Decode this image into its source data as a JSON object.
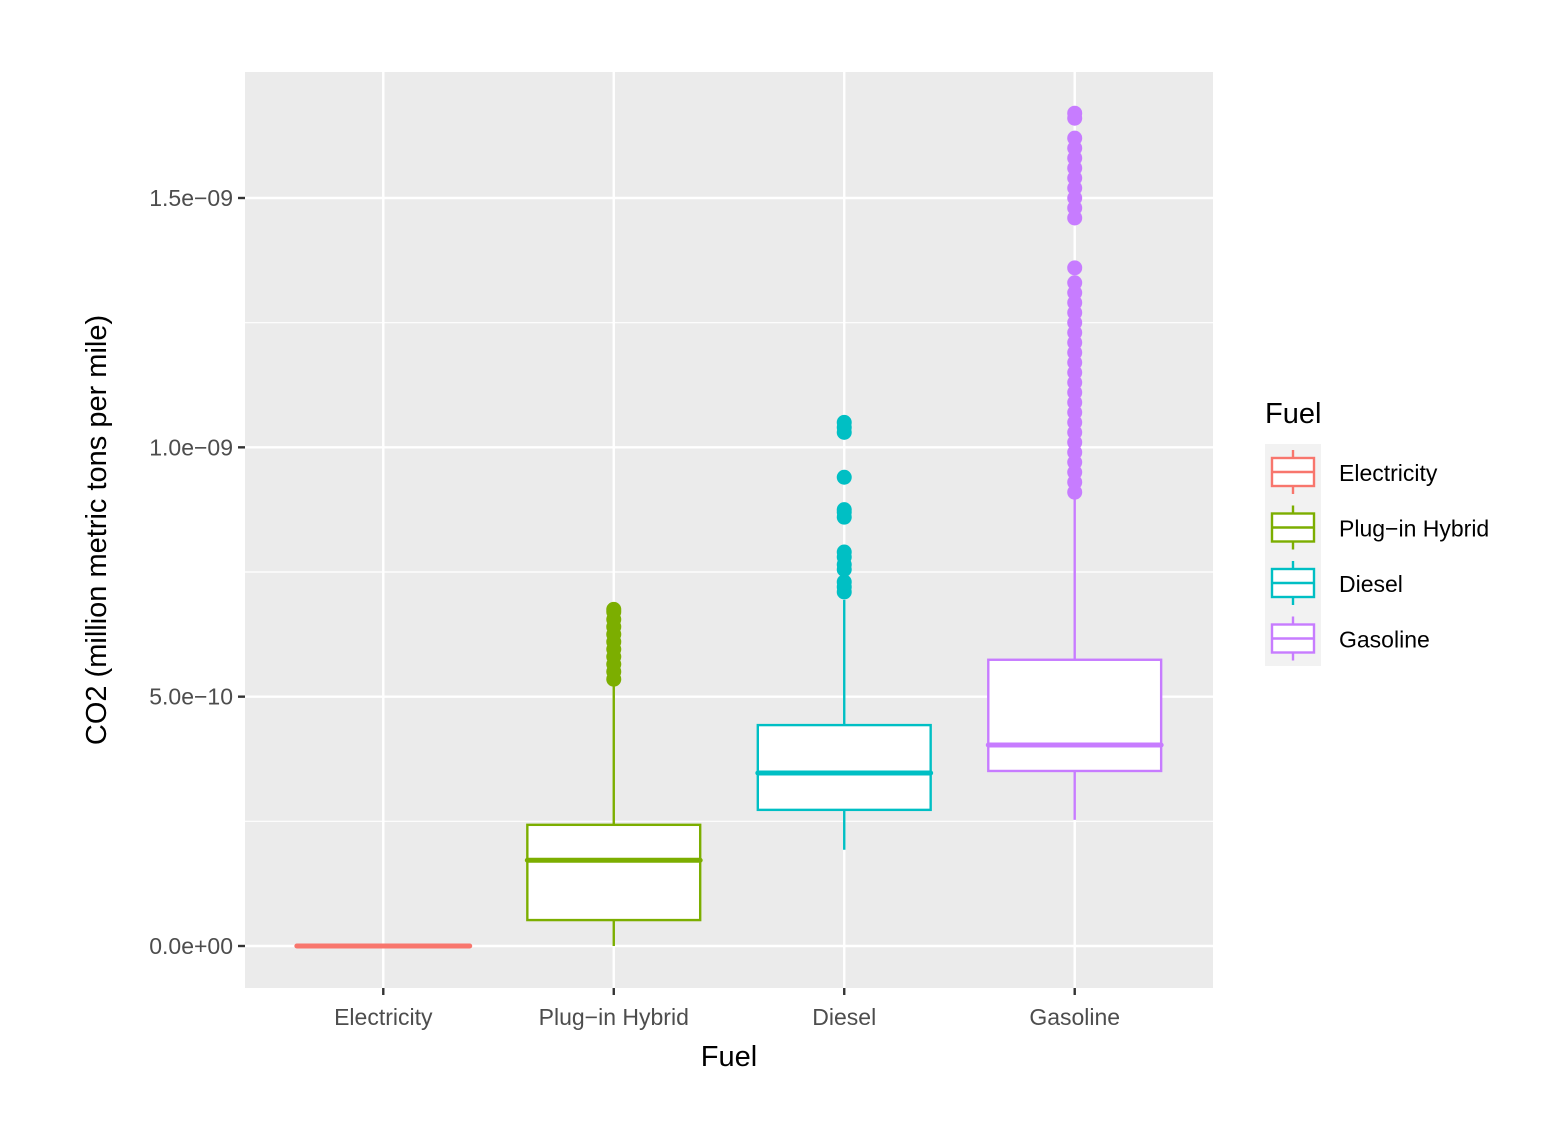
{
  "chart_data": {
    "type": "box",
    "title": "",
    "xlabel": "Fuel",
    "ylabel": "CO2 (million metric tons per mile)",
    "categories": [
      "Electricity",
      "Plug−in Hybrid",
      "Diesel",
      "Gasoline"
    ],
    "ylim": [
      -8.5e-11,
      1.75e-09
    ],
    "yticks": [
      0,
      5e-10,
      1e-09,
      1.5e-09
    ],
    "ytick_labels": [
      "0.0e+00",
      "5.0e−10",
      "1.0e−09",
      "1.5e−09"
    ],
    "grid": true,
    "legend": {
      "title": "Fuel",
      "position": "right",
      "entries": [
        "Electricity",
        "Plug−in Hybrid",
        "Diesel",
        "Gasoline"
      ]
    },
    "series": [
      {
        "name": "Electricity",
        "color": "#F8766D",
        "whisker_low": 0,
        "q1": 0,
        "median": 0,
        "q3": 0,
        "whisker_high": 0,
        "outliers": []
      },
      {
        "name": "Plug−in Hybrid",
        "color": "#7CAE00",
        "whisker_low": 0,
        "q1": 5.2e-11,
        "median": 1.72e-10,
        "q3": 2.43e-10,
        "whisker_high": 5.3e-10,
        "outliers": [
          5.35e-10,
          5.5e-10,
          5.65e-10,
          5.8e-10,
          5.95e-10,
          6.1e-10,
          6.25e-10,
          6.4e-10,
          6.55e-10,
          6.7e-10,
          6.75e-10
        ]
      },
      {
        "name": "Diesel",
        "color": "#00BFC4",
        "whisker_low": 1.93e-10,
        "q1": 2.73e-10,
        "median": 3.47e-10,
        "q3": 4.43e-10,
        "whisker_high": 6.94e-10,
        "outliers": [
          7.1e-10,
          7.2e-10,
          7.3e-10,
          7.55e-10,
          7.65e-10,
          7.8e-10,
          7.9e-10,
          8.6e-10,
          8.7e-10,
          8.75e-10,
          9.4e-10,
          1.03e-09,
          1.04e-09,
          1.05e-09
        ]
      },
      {
        "name": "Gasoline",
        "color": "#C77CFF",
        "whisker_low": 2.53e-10,
        "q1": 3.51e-10,
        "median": 4.03e-10,
        "q3": 5.74e-10,
        "whisker_high": 9.04e-10,
        "outliers": [
          9.1e-10,
          9.3e-10,
          9.5e-10,
          9.7e-10,
          9.9e-10,
          1.01e-09,
          1.03e-09,
          1.05e-09,
          1.07e-09,
          1.09e-09,
          1.11e-09,
          1.13e-09,
          1.15e-09,
          1.17e-09,
          1.19e-09,
          1.21e-09,
          1.23e-09,
          1.25e-09,
          1.27e-09,
          1.29e-09,
          1.31e-09,
          1.33e-09,
          1.36e-09,
          1.46e-09,
          1.48e-09,
          1.5e-09,
          1.52e-09,
          1.54e-09,
          1.56e-09,
          1.58e-09,
          1.6e-09,
          1.62e-09,
          1.66e-09,
          1.67e-09
        ]
      }
    ]
  }
}
